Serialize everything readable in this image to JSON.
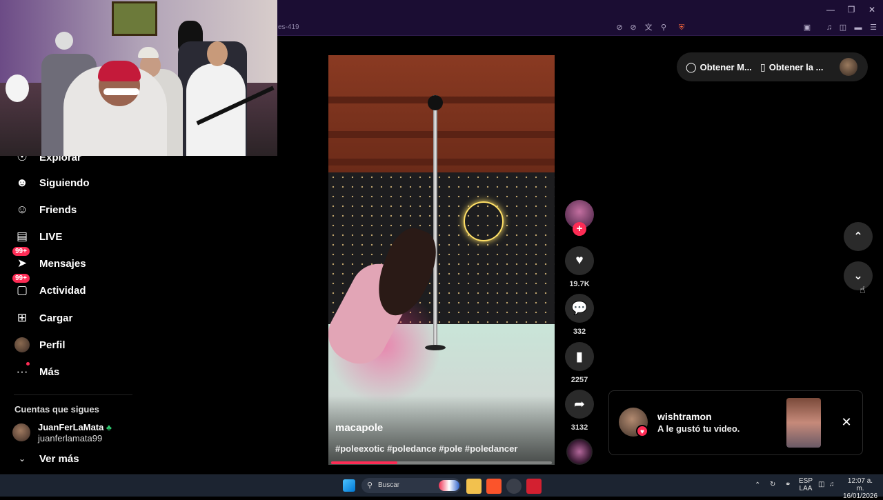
{
  "browser": {
    "url_fragment": "es-419",
    "window_controls": [
      "minimize-icon",
      "restore-icon",
      "close-icon"
    ],
    "toolbar_icons": [
      "mute-icon",
      "mic-off-icon",
      "translate-icon",
      "zoom-icon",
      "brave-shield-icon",
      "reader-icon",
      "music-icon",
      "sidebar-icon",
      "wallet-icon",
      "menu-icon"
    ]
  },
  "sidebar": {
    "items": [
      {
        "label": "Explorar",
        "icon": "explore-icon"
      },
      {
        "label": "Siguiendo",
        "icon": "following-icon"
      },
      {
        "label": "Friends",
        "icon": "friends-icon"
      },
      {
        "label": "LIVE",
        "icon": "live-icon"
      },
      {
        "label": "Mensajes",
        "icon": "messages-icon",
        "badge": "99+"
      },
      {
        "label": "Actividad",
        "icon": "activity-icon",
        "badge": "99+"
      },
      {
        "label": "Cargar",
        "icon": "upload-icon"
      },
      {
        "label": "Perfil",
        "icon": "profile-avatar"
      },
      {
        "label": "Más",
        "icon": "more-icon"
      }
    ],
    "following_title": "Cuentas que sigues",
    "following": [
      {
        "name": "JuanFerLaMata",
        "handle": "juanferlamata99"
      }
    ],
    "see_more": "Ver más"
  },
  "video": {
    "author": "macapole",
    "tags": "#poleexotic #poledance #pole #poledancer",
    "progress": 0.3
  },
  "actions": {
    "likes": "19.7K",
    "comments": "332",
    "saves": "2257",
    "shares": "3132"
  },
  "top_pill": {
    "get_app": "Obtener M...",
    "get_device": "Obtener la ..."
  },
  "notification": {
    "user": "wishtramon",
    "message": "A le gustó tu video."
  },
  "taskbar": {
    "search_placeholder": "Buscar",
    "lang_top": "ESP",
    "lang_bottom": "LAA",
    "time": "12:07 a. m.",
    "date": "16/01/2026"
  },
  "colors": {
    "accent": "#fe2c55",
    "browser_bar": "#1b0d33",
    "taskbar": "#1c2431"
  }
}
